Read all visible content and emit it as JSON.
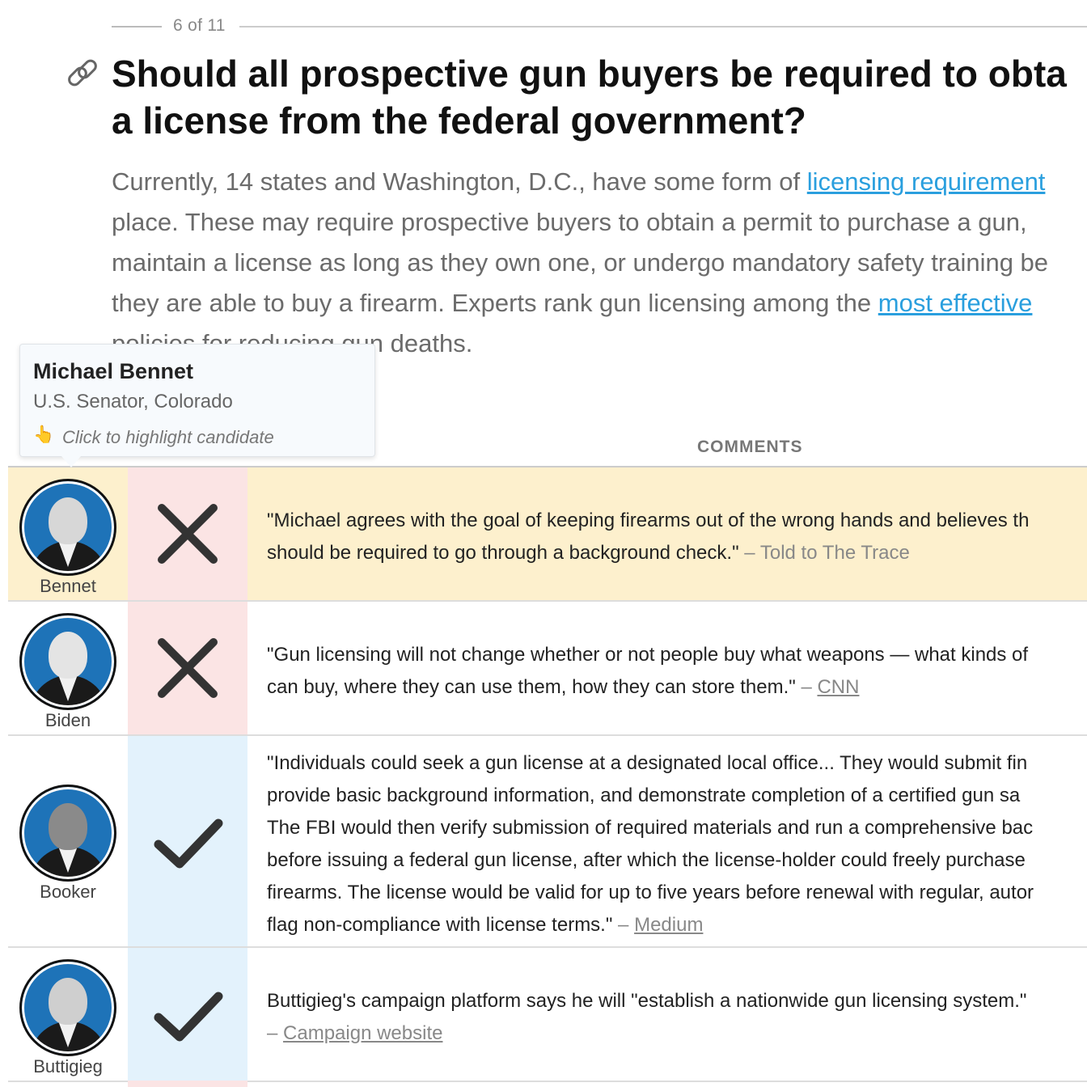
{
  "counter": {
    "text": "6 of 11"
  },
  "question": {
    "line1": "Should all prospective gun buyers be required to obta",
    "line2": "a license from the federal government?"
  },
  "intro": {
    "l1_pre": "Currently, 14 states and Washington, D.C., have some form of ",
    "l1_link": "licensing requirement",
    "l2": "place. These may require prospective buyers to obtain a permit to purchase a gun,",
    "l3": "maintain a license as long as they own one, or undergo mandatory safety training be",
    "l4_pre": "they are able to buy a firearm. Experts rank gun licensing among the ",
    "l4_link": "most effective",
    "l5": "policies for reducing gun deaths."
  },
  "tooltip": {
    "name": "Michael Bennet",
    "role": "U.S. Senator, Colorado",
    "hint_icon": "pointing-hand-icon",
    "hint": "Click to highlight candidate"
  },
  "table": {
    "comments_header": "COMMENTS",
    "rows": [
      {
        "candidate": "Bennet",
        "position": "no",
        "lines": [
          "\"Michael agrees with the goal of keeping firearms out of the wrong hands and believes th",
          "should be required to go through a background check.\""
        ],
        "source": "Told to The Trace",
        "highlighted": true
      },
      {
        "candidate": "Biden",
        "position": "no",
        "lines": [
          "\"Gun licensing will not change whether or not people buy what weapons — what kinds of",
          "can buy, where they can use them, how they can store them.\""
        ],
        "source": "CNN"
      },
      {
        "candidate": "Booker",
        "position": "yes",
        "lines": [
          "\"Individuals could seek a gun license at a designated local office... They would submit fin",
          "provide basic background information, and demonstrate completion of a certified gun sa",
          "The FBI would then verify submission of required materials and run a comprehensive bac",
          "before issuing a federal gun license, after which the license-holder could freely purchase",
          "firearms. The license would be valid for up to five years before renewal with regular, autor",
          "flag non-compliance with license terms.\""
        ],
        "source": "Medium"
      },
      {
        "candidate": "Buttigieg",
        "position": "yes",
        "lines": [
          "Buttigieg's campaign platform says he will \"establish a nationwide gun licensing system.\"",
          ""
        ],
        "source": "Campaign website"
      }
    ],
    "dash": "–"
  },
  "colors": {
    "highlight_row": "#fdf0cd",
    "no_column": "#fbe4e4",
    "yes_column": "#e3f2fc",
    "link": "#2a9fde",
    "avatar_bg": "#1e73b8"
  },
  "icons": {
    "link": "link-icon",
    "no": "x-icon",
    "yes": "check-icon"
  }
}
